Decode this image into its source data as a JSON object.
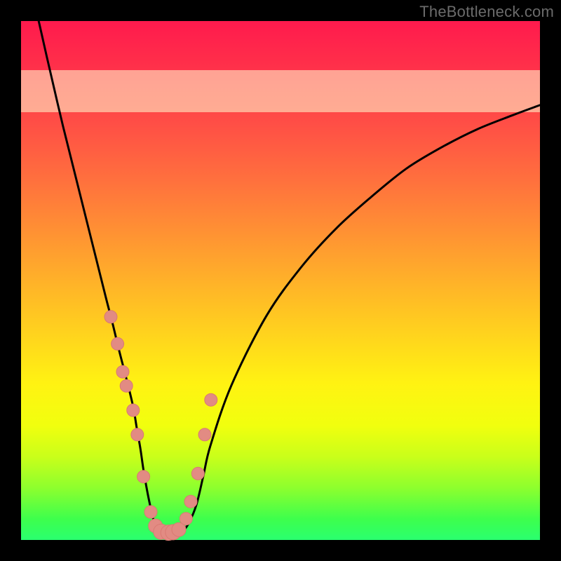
{
  "watermark": "TheBottleneck.com",
  "colors": {
    "frame": "#000000",
    "curve": "#000000",
    "marker_fill": "#e28b83",
    "marker_stroke": "#d97a72",
    "band": "rgba(255,255,210,0.55)"
  },
  "chart_data": {
    "type": "line",
    "title": "",
    "xlabel": "",
    "ylabel": "",
    "xlim": [
      0,
      100
    ],
    "ylim": [
      0,
      100
    ],
    "grid": false,
    "legend": false,
    "annotations": [
      "TheBottleneck.com"
    ],
    "note": "No axis ticks or numeric labels are rendered in the image; x/y are normalized 0–100 from pixel positions within the 740×740 plot area. y is measured from the bottom of the plot upward.",
    "series": [
      {
        "name": "bottleneck-curve",
        "x": [
          3.4,
          5.4,
          8.1,
          10.8,
          13.5,
          16.2,
          17.6,
          18.9,
          20.3,
          21.6,
          22.3,
          23.0,
          23.6,
          24.3,
          25.0,
          25.7,
          27.0,
          28.4,
          29.7,
          31.1,
          32.4,
          33.8,
          35.1,
          36.5,
          40.5,
          47.3,
          54.1,
          60.8,
          67.6,
          74.3,
          81.1,
          87.8,
          94.6,
          100.0
        ],
        "y": [
          100.0,
          91.2,
          79.7,
          68.9,
          58.1,
          47.3,
          41.9,
          36.5,
          31.1,
          25.7,
          21.6,
          17.6,
          13.5,
          9.5,
          6.1,
          3.4,
          1.6,
          1.1,
          1.1,
          1.6,
          3.4,
          6.8,
          12.2,
          18.2,
          29.7,
          43.2,
          52.7,
          60.1,
          66.2,
          71.6,
          75.7,
          79.1,
          81.8,
          83.8
        ]
      }
    ],
    "markers": {
      "name": "highlight-dots",
      "x": [
        17.3,
        18.6,
        19.6,
        20.3,
        21.6,
        22.4,
        23.6,
        25.0,
        25.9,
        27.0,
        28.4,
        29.3,
        30.4,
        31.8,
        32.7,
        34.1,
        35.4,
        36.6
      ],
      "y": [
        43.0,
        37.8,
        32.4,
        29.7,
        25.0,
        20.3,
        12.2,
        5.4,
        2.7,
        1.6,
        1.4,
        1.5,
        2.0,
        4.1,
        7.4,
        12.8,
        20.3,
        27.0
      ],
      "radius_px": [
        9,
        9,
        9,
        9,
        9,
        9,
        9,
        9,
        10,
        11,
        11,
        11,
        10,
        9,
        9,
        9,
        9,
        9
      ]
    },
    "band": {
      "y_from": 82.4,
      "y_to": 90.5
    }
  }
}
